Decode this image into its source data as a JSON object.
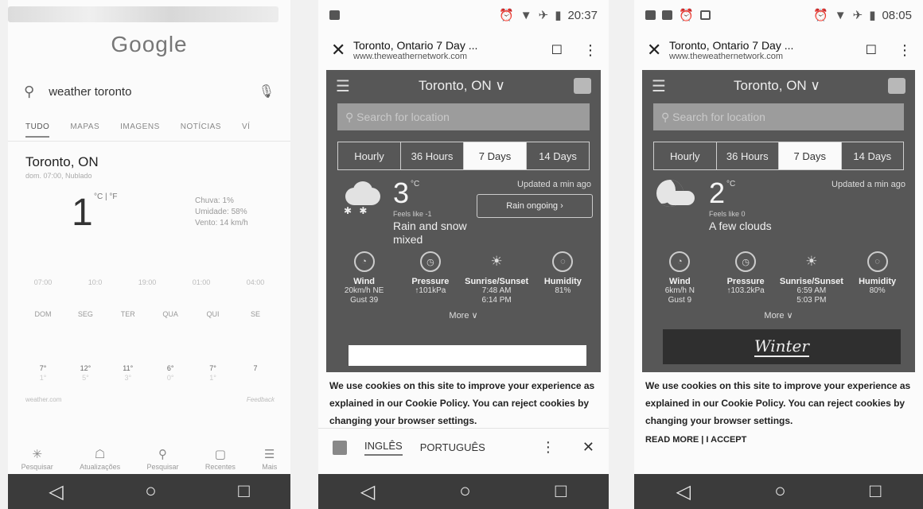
{
  "navbar": {
    "back": "◁",
    "home": "○",
    "recents": "□"
  },
  "phone1": {
    "logo": "Google",
    "search": {
      "query": "weather toronto"
    },
    "tabs": [
      "TUDO",
      "MAPAS",
      "IMAGENS",
      "NOTÍCIAS",
      "VÍ"
    ],
    "city": "Toronto, ON",
    "date": "dom. 07:00, Nublado",
    "temp": "1",
    "unit_toggle": "°C | °F",
    "details": [
      "Chuva: 1%",
      "Umidade: 58%",
      "Vento: 14 km/h"
    ],
    "hours": [
      "07:00",
      "10:0",
      "19:00",
      "01:00",
      "04:00"
    ],
    "days": [
      {
        "name": "DOM",
        "hi": "7°",
        "lo": "1°"
      },
      {
        "name": "SEG",
        "hi": "12°",
        "lo": "5°"
      },
      {
        "name": "TER",
        "hi": "11°",
        "lo": "3°"
      },
      {
        "name": "QUA",
        "hi": "6°",
        "lo": "0°"
      },
      {
        "name": "QUI",
        "hi": "7°",
        "lo": "1°"
      },
      {
        "name": "SE",
        "hi": "7",
        "lo": ""
      }
    ],
    "source": "weather.com",
    "feedback": "Feedback",
    "bottom_nav": [
      {
        "icon": "✳",
        "label": "Pesquisar"
      },
      {
        "icon": "☖",
        "label": "Atualizações"
      },
      {
        "icon": "⚲",
        "label": "Pesquisar"
      },
      {
        "icon": "▢",
        "label": "Recentes"
      },
      {
        "icon": "☰",
        "label": "Mais"
      }
    ]
  },
  "phone2": {
    "status": {
      "time": "20:37"
    },
    "page_title": "Toronto, Ontario 7 Day ...",
    "page_url": "www.theweathernetwork.com",
    "location": "Toronto, ON",
    "search_placeholder": "Search for location",
    "tabs": [
      "Hourly",
      "36 Hours",
      "7 Days",
      "14 Days"
    ],
    "temp": "3",
    "temp_unit": "°C",
    "feels_like": "Feels like -1",
    "condition": "Rain and snow mixed",
    "updated": "Updated a min ago",
    "rain_button": "Rain ongoing ›",
    "metrics": [
      {
        "icon": "◔",
        "label": "Wind",
        "v1": "20km/h NE",
        "v2": "Gust 39"
      },
      {
        "icon": "◷",
        "label": "Pressure",
        "v1": "↑101kPa",
        "v2": ""
      },
      {
        "icon": "☀",
        "label": "Sunrise/Sunset",
        "v1": "7:48 AM",
        "v2": "6:14 PM"
      },
      {
        "icon": "◌",
        "label": "Humidity",
        "v1": "81%",
        "v2": ""
      }
    ],
    "more": "More ∨",
    "cookie_text": "We use cookies on this site to improve your experience as explained in our Cookie Policy. You can reject cookies by changing your browser settings.",
    "translate": {
      "lang1": "INGLÊS",
      "lang2": "PORTUGUÊS"
    }
  },
  "phone3": {
    "status": {
      "time": "08:05"
    },
    "page_title": "Toronto, Ontario 7 Day ...",
    "page_url": "www.theweathernetwork.com",
    "location": "Toronto, ON",
    "search_placeholder": "Search for location",
    "tabs": [
      "Hourly",
      "36 Hours",
      "7 Days",
      "14 Days"
    ],
    "temp": "2",
    "temp_unit": "°C",
    "feels_like": "Feels like 0",
    "condition": "A few clouds",
    "updated": "Updated a min ago",
    "metrics": [
      {
        "icon": "◔",
        "label": "Wind",
        "v1": "6km/h N",
        "v2": "Gust 9"
      },
      {
        "icon": "◷",
        "label": "Pressure",
        "v1": "↑103.2kPa",
        "v2": ""
      },
      {
        "icon": "☀",
        "label": "Sunrise/Sunset",
        "v1": "6:59 AM",
        "v2": "5:03 PM"
      },
      {
        "icon": "◌",
        "label": "Humidity",
        "v1": "80%",
        "v2": ""
      }
    ],
    "more": "More ∨",
    "banner": "Winter",
    "cookie_text": "We use cookies on this site to improve your experience as explained in our Cookie Policy. You can reject cookies by changing your browser settings.",
    "cookie_links": "READ MORE | I ACCEPT"
  }
}
